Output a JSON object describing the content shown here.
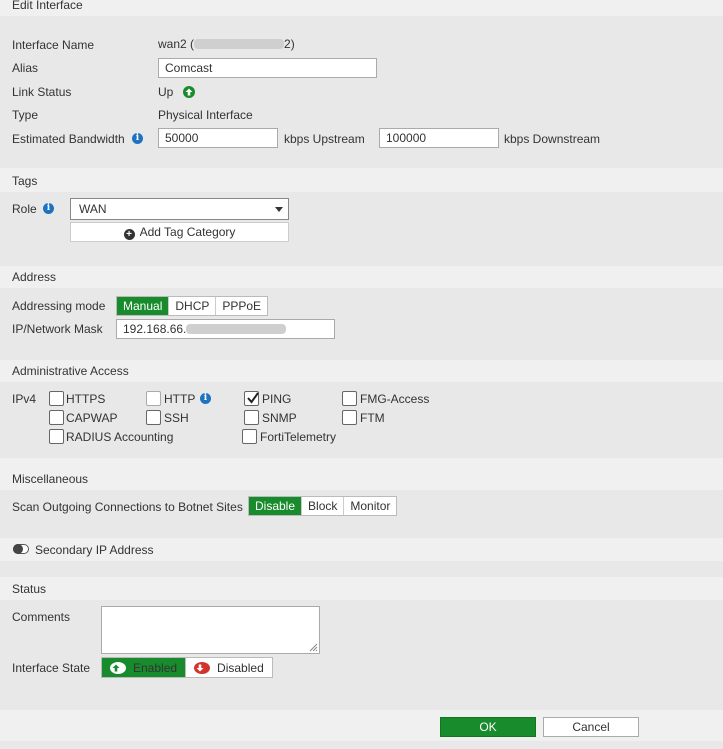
{
  "title": "Edit Interface",
  "interface": {
    "name_label": "Interface Name",
    "name_value_prefix": "wan2 (",
    "name_value_suffix": "2)",
    "alias_label": "Alias",
    "alias_value": "Comcast",
    "link_status_label": "Link Status",
    "link_status_value": "Up",
    "type_label": "Type",
    "type_value": "Physical Interface",
    "bandwidth_label": "Estimated Bandwidth",
    "upstream_value": "50000",
    "upstream_unit": "kbps Upstream",
    "downstream_value": "100000",
    "downstream_unit": "kbps Downstream"
  },
  "tags": {
    "header": "Tags",
    "role_label": "Role",
    "role_value": "WAN",
    "add_tag_label": "Add Tag Category"
  },
  "address": {
    "header": "Address",
    "mode_label": "Addressing mode",
    "modes": [
      "Manual",
      "DHCP",
      "PPPoE"
    ],
    "selected_mode": "Manual",
    "ip_label": "IP/Network Mask",
    "ip_value_prefix": "192.168.66."
  },
  "admin": {
    "header": "Administrative Access",
    "ipv4_label": "IPv4",
    "options": [
      {
        "label": "HTTPS",
        "checked": false
      },
      {
        "label": "HTTP",
        "checked": false
      },
      {
        "label": "PING",
        "checked": true
      },
      {
        "label": "FMG-Access",
        "checked": false
      },
      {
        "label": "CAPWAP",
        "checked": false
      },
      {
        "label": "SSH",
        "checked": false
      },
      {
        "label": "SNMP",
        "checked": false
      },
      {
        "label": "FTM",
        "checked": false
      },
      {
        "label": "RADIUS Accounting",
        "checked": false
      },
      {
        "label": "FortiTelemetry",
        "checked": false
      }
    ]
  },
  "misc": {
    "header": "Miscellaneous",
    "botnet_label": "Scan Outgoing Connections to Botnet Sites",
    "botnet_options": [
      "Disable",
      "Block",
      "Monitor"
    ],
    "botnet_selected": "Disable"
  },
  "secondary": {
    "label": "Secondary IP Address",
    "enabled": false
  },
  "status": {
    "header": "Status",
    "comments_label": "Comments",
    "comments_value": "",
    "state_label": "Interface State",
    "enabled_label": "Enabled",
    "disabled_label": "Disabled",
    "state": "Enabled"
  },
  "footer": {
    "ok_label": "OK",
    "cancel_label": "Cancel"
  },
  "colors": {
    "accent_green": "#188b2c",
    "info_blue": "#1e73be",
    "disabled_red": "#d0342c"
  }
}
